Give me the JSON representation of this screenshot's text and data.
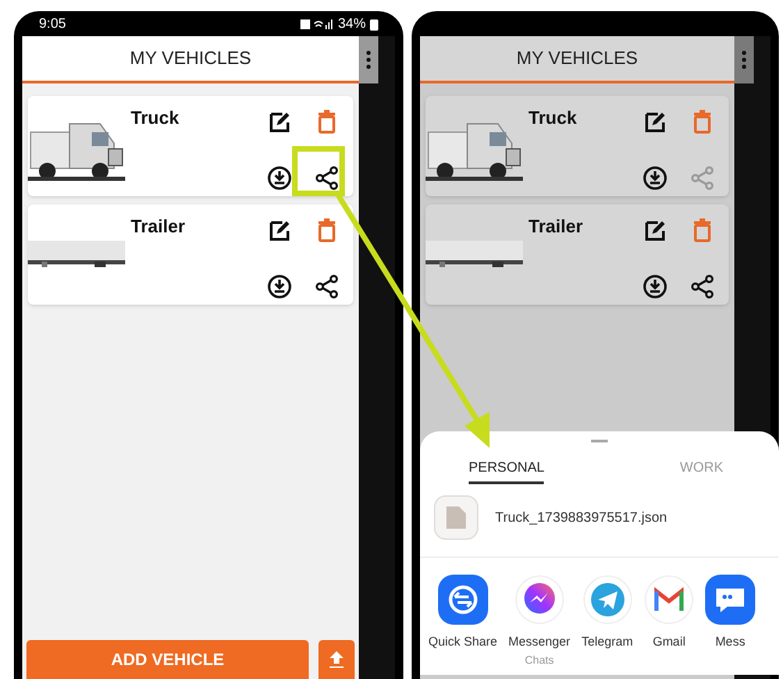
{
  "phones": [
    {
      "status_bar": {
        "time": "9:05",
        "battery": "34%"
      },
      "dimmed": false,
      "app_bar": {
        "title": "MY VEHICLES"
      },
      "vehicles": [
        {
          "name": "Truck",
          "kind": "truck",
          "share_disabled": false
        },
        {
          "name": "Trailer",
          "kind": "trailer",
          "share_disabled": false
        }
      ],
      "add_button": "ADD VEHICLE"
    },
    {
      "dimmed": true,
      "app_bar": {
        "title": "MY VEHICLES"
      },
      "vehicles": [
        {
          "name": "Truck",
          "kind": "truck",
          "share_disabled": true
        },
        {
          "name": "Trailer",
          "kind": "trailer",
          "share_disabled": false
        }
      ],
      "share_sheet": {
        "tabs": [
          {
            "label": "PERSONAL",
            "selected": true
          },
          {
            "label": "WORK",
            "selected": false
          }
        ],
        "file_name": "Truck_1739883975517.json",
        "apps": [
          {
            "name": "Quick Share",
            "kind": "quickshare"
          },
          {
            "name": "Messenger",
            "subtitle": "Chats",
            "kind": "messenger"
          },
          {
            "name": "Telegram",
            "kind": "telegram"
          },
          {
            "name": "Gmail",
            "kind": "gmail"
          },
          {
            "name": "Mess",
            "kind": "messages"
          }
        ]
      }
    }
  ]
}
